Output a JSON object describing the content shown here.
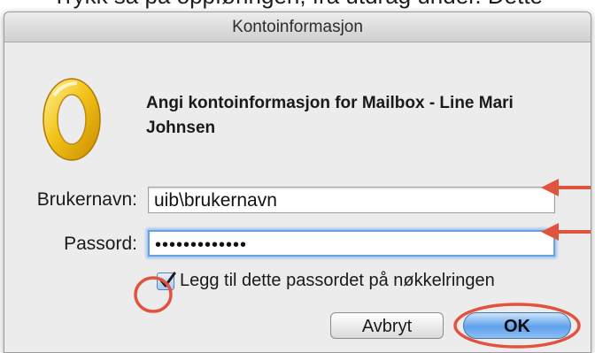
{
  "page": {
    "caption": "Trykk så på oppføringen, fra utdrag under. Dette"
  },
  "window": {
    "title": "Kontoinformasjon"
  },
  "dialog": {
    "heading": "Angi kontoinformasjon for Mailbox - Line Mari Johnsen",
    "username": {
      "label": "Brukernavn:",
      "value": "uib\\brukernavn"
    },
    "password": {
      "label": "Passord:",
      "value": "•••••••••••••"
    },
    "keychain_checkbox": {
      "label": "Legg til dette passordet på nøkkelringen",
      "checked": true
    },
    "buttons": {
      "cancel_label": "Avbryt",
      "ok_label": "OK"
    }
  },
  "icons": {
    "app_icon": "outlook-icon",
    "arrow_icon": "arrow-left-icon"
  },
  "colors": {
    "annotation": "#e2533d",
    "ok_button": "#5da0ec",
    "focus_ring": "#6aa0e0"
  }
}
